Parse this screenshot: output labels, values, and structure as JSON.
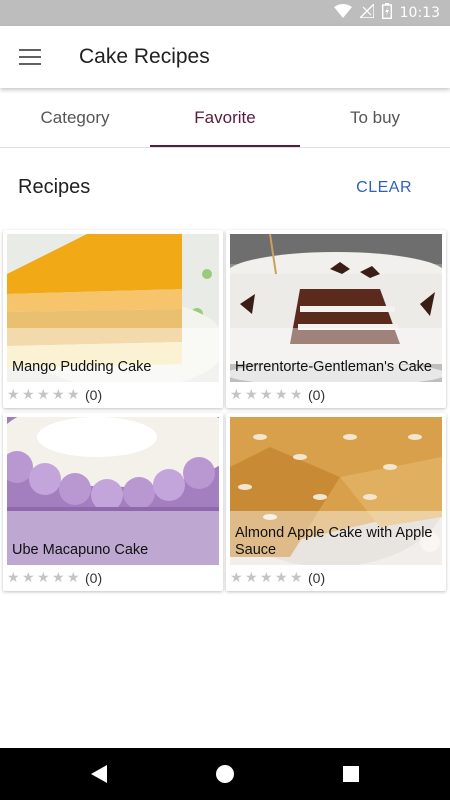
{
  "status_bar": {
    "time": "10:13"
  },
  "app_bar": {
    "title": "Cake Recipes",
    "menu_icon": "hamburger-menu-icon"
  },
  "tabs": [
    {
      "label": "Category",
      "active": false
    },
    {
      "label": "Favorite",
      "active": true
    },
    {
      "label": "To buy",
      "active": false
    }
  ],
  "section": {
    "title": "Recipes",
    "clear_label": "CLEAR"
  },
  "recipes": [
    {
      "name": "Mango Pudding Cake",
      "rating": 0,
      "count": "(0)"
    },
    {
      "name": "Herrentorte-Gentleman's Cake",
      "rating": 0,
      "count": "(0)"
    },
    {
      "name": "Ube Macapuno Cake",
      "rating": 0,
      "count": "(0)"
    },
    {
      "name": "Almond Apple Cake with Apple Sauce",
      "rating": 0,
      "count": "(0)"
    }
  ],
  "colors": {
    "accent": "#5c1a3b",
    "clear": "#2f5fc4",
    "status_bar": "#bdbdbd",
    "nav_bar": "#000000"
  }
}
